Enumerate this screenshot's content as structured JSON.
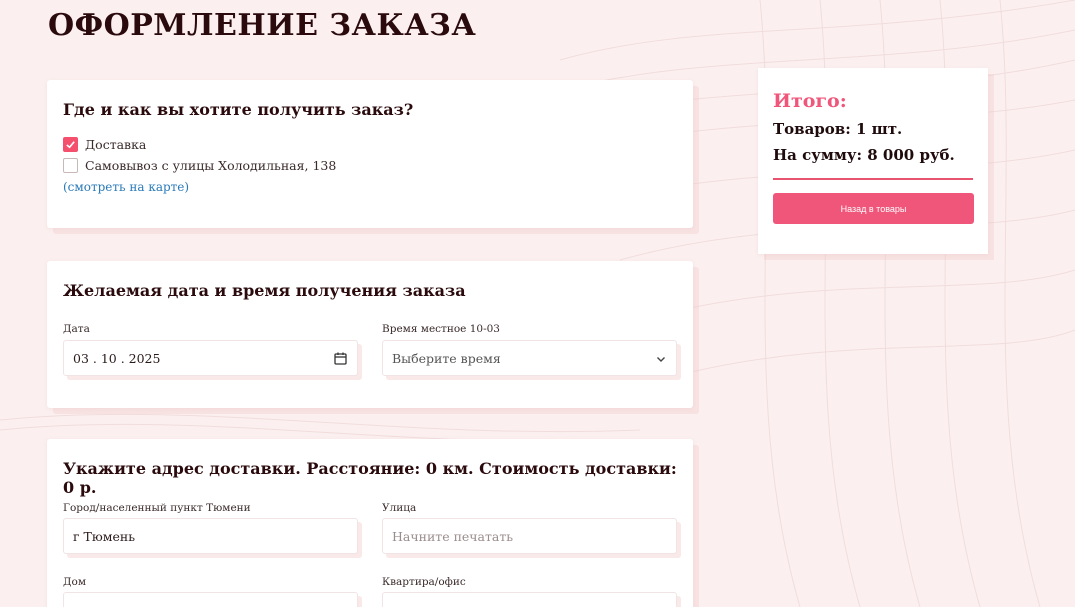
{
  "page": {
    "title": "ОФОРМЛЕНИЕ ЗАКАЗА"
  },
  "delivery_method": {
    "heading": "Где и как вы хотите получить заказ?",
    "options": [
      {
        "label": "Доставка",
        "checked": true
      },
      {
        "label": "Самовывоз с улицы Холодильная, 138",
        "checked": false
      }
    ],
    "map_link": "(смотреть на карте)"
  },
  "datetime": {
    "heading": "Желаемая дата и время получения заказа",
    "date_label": "Дата",
    "date_value": "03 . 10 . 2025",
    "time_label": "Время местное 10-03",
    "time_placeholder": "Выберите время"
  },
  "address": {
    "heading": "Укажите адрес доставки. Расстояние: 0 км. Стоимость доставки: 0 р.",
    "city_label": "Город/населенный пункт Тюмени",
    "city_value": "г Тюмень",
    "street_label": "Улица",
    "street_placeholder": "Начните печатать",
    "house_label": "Дом",
    "apartment_label": "Квартира/офис"
  },
  "summary": {
    "title": "Итого:",
    "items_line": "Товаров: 1 шт.",
    "sum_line": "На сумму: 8 000 руб.",
    "back_button": "Назад в товары"
  },
  "colors": {
    "accent": "#f0557a",
    "link": "#2a7ab8",
    "background": "#fbf0ef"
  }
}
